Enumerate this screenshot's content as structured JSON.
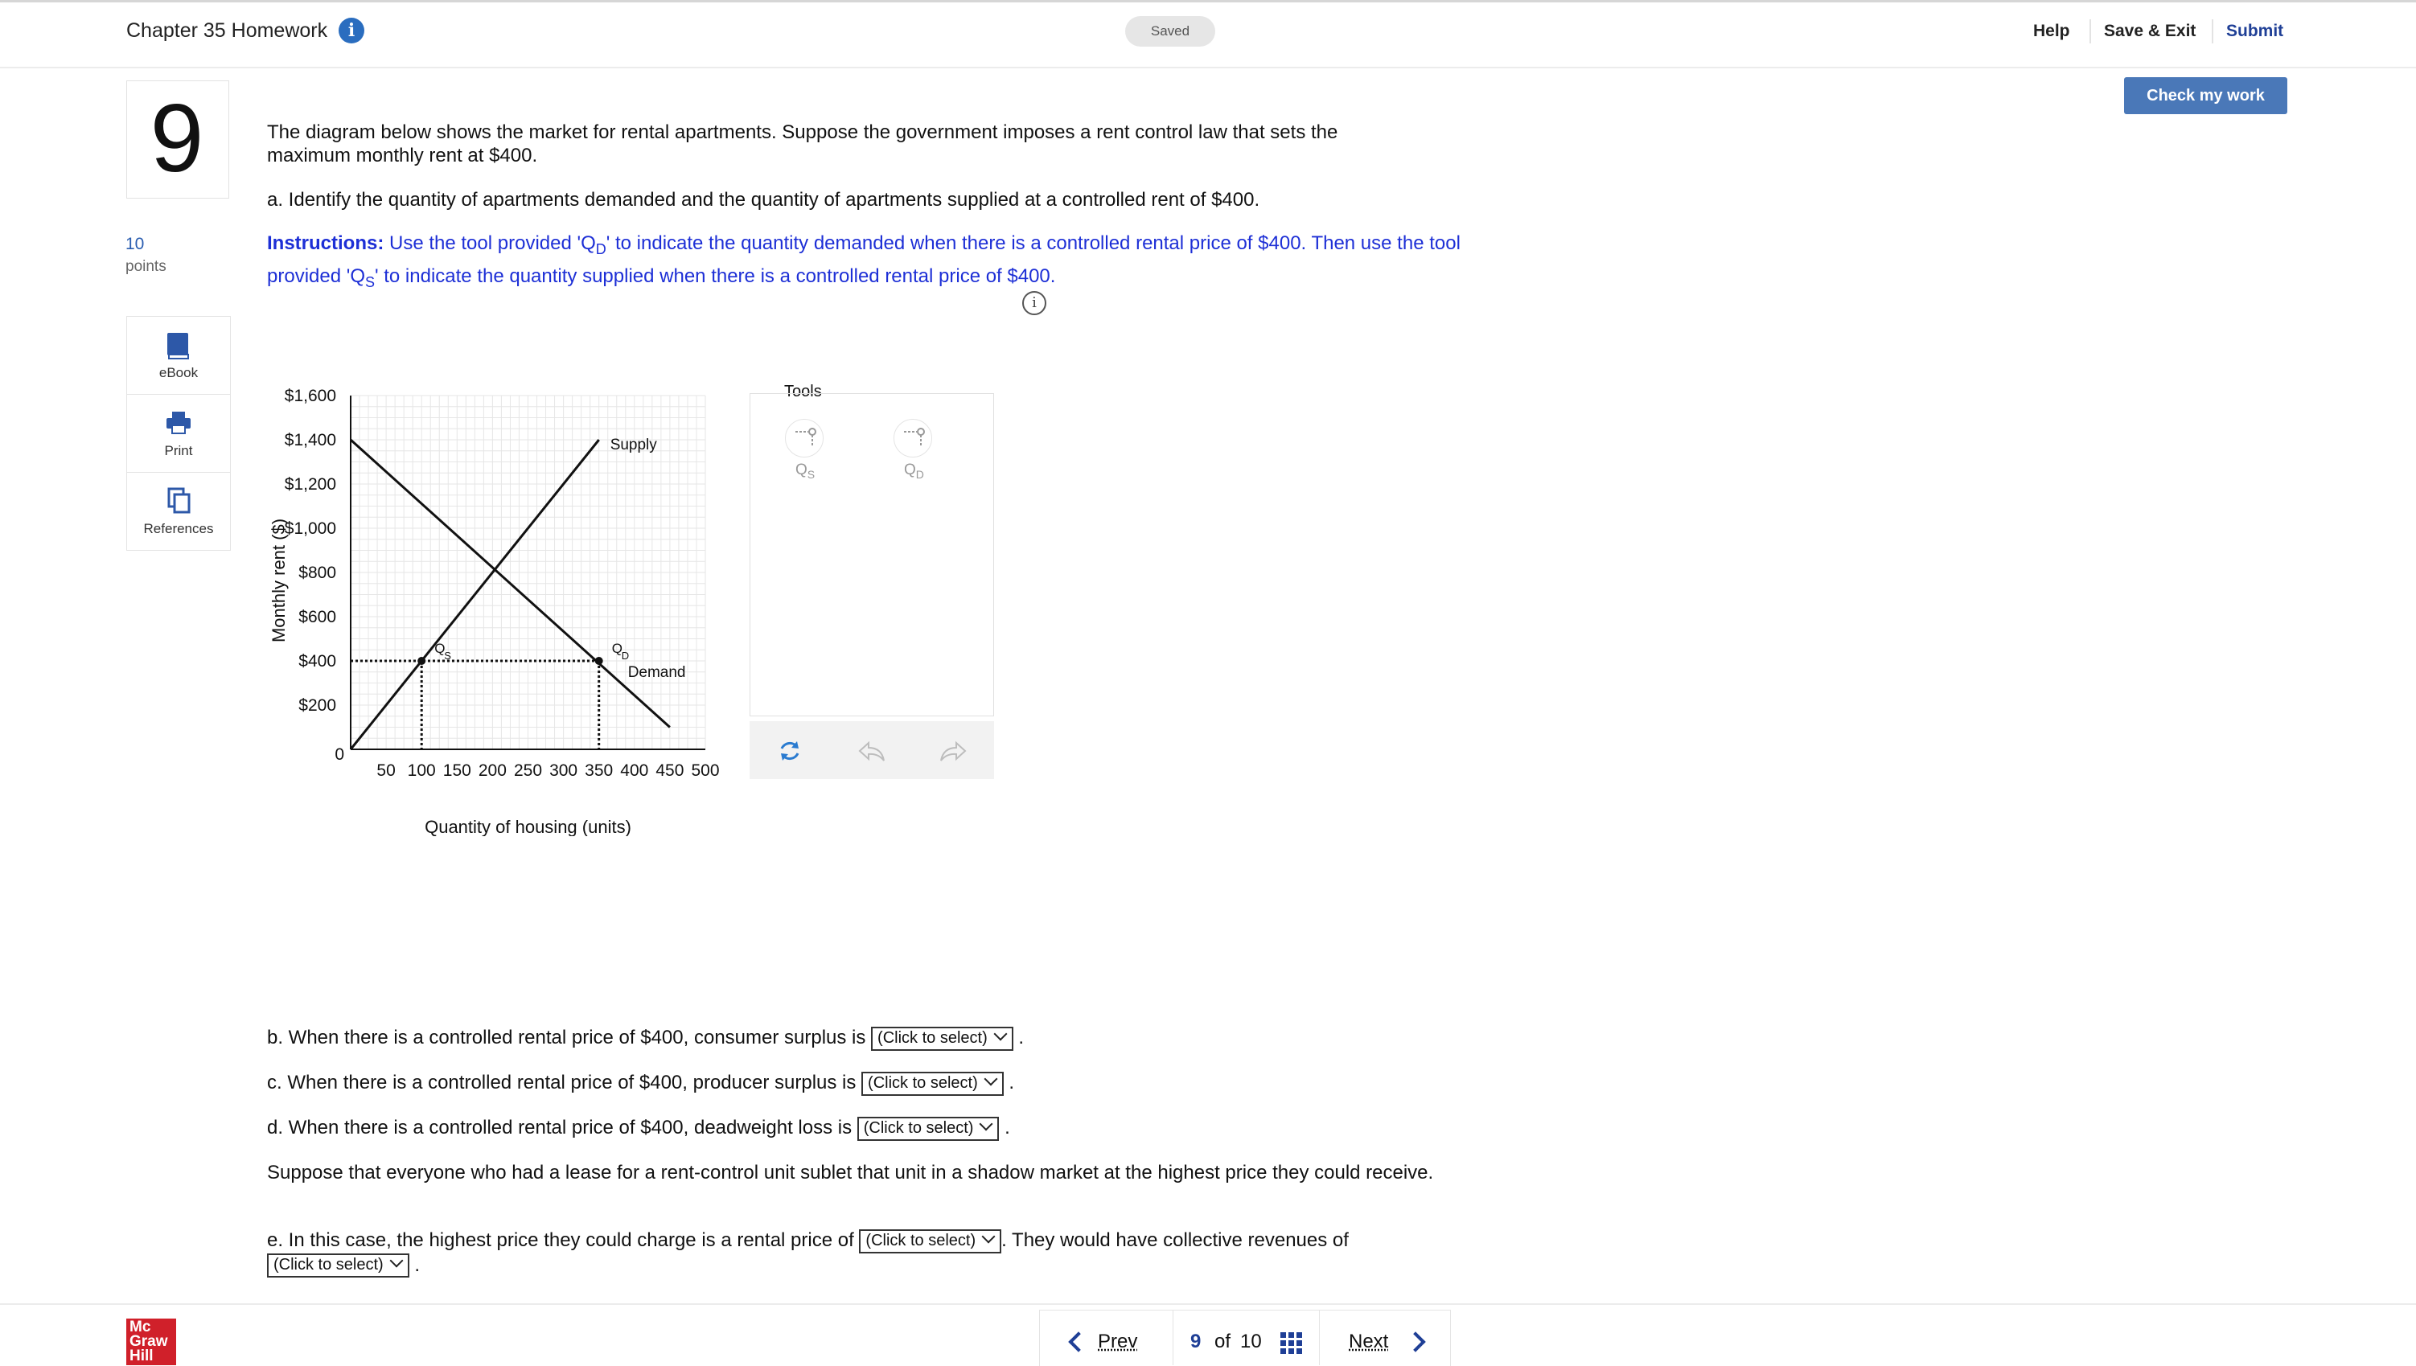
{
  "header": {
    "title": "Chapter 35 Homework",
    "saved": "Saved",
    "help": "Help",
    "save_exit": "Save & Exit",
    "submit": "Submit",
    "check": "Check my work"
  },
  "question": {
    "number": "9",
    "points_value": "10",
    "points_label": "points",
    "intro": "The diagram below shows the market for rental apartments. Suppose the government imposes a rent control law that sets the maximum monthly rent at $400.",
    "part_a": "a. Identify the quantity of apartments demanded and the quantity of apartments supplied at a controlled rent of $400.",
    "instr_bold": "Instructions:",
    "instr_1": " Use the tool provided 'Q",
    "instr_sub_d": "D",
    "instr_2": "' to indicate the quantity demanded when there is a controlled rental price of $400. Then use the tool provided 'Q",
    "instr_sub_s": "S",
    "instr_3": "' to indicate the quantity supplied when there is a controlled rental price of $400.",
    "part_b": "b. When there is a controlled rental price of $400, consumer surplus is",
    "part_c": "c. When there is a controlled rental price of $400, producer surplus is",
    "part_d": "d. When there is a controlled rental price of $400, deadweight loss is",
    "suppose": "Suppose that everyone who had a lease for a rent-control unit sublet that unit in a shadow market at the highest price they could receive.",
    "part_e_1": "e. In this case, the highest price they could charge is a rental price of",
    "part_e_2": ". They would have collective revenues of",
    "select_placeholder": "(Click to select)",
    "period": "."
  },
  "sidebar": {
    "ebook": "eBook",
    "print": "Print",
    "references": "References"
  },
  "tools": {
    "title": "Tools",
    "qs_label": "Q",
    "qs_sub": "S",
    "qd_label": "Q",
    "qd_sub": "D"
  },
  "chart_data": {
    "type": "line",
    "xlabel": "Quantity of housing (units)",
    "ylabel": "Monthly rent ($)",
    "xlim": [
      0,
      500
    ],
    "ylim": [
      0,
      1600
    ],
    "x_ticks": [
      "50",
      "100",
      "150",
      "200",
      "250",
      "300",
      "350",
      "400",
      "450",
      "500"
    ],
    "y_ticks": [
      "$200",
      "$400",
      "$600",
      "$800",
      "$1,000",
      "$1,200",
      "$1,400",
      "$1,600"
    ],
    "origin_label": "0",
    "grid": true,
    "series": [
      {
        "name": "Supply",
        "points": [
          [
            0,
            0
          ],
          [
            350,
            1400
          ]
        ]
      },
      {
        "name": "Demand",
        "points": [
          [
            0,
            1400
          ],
          [
            450,
            100
          ]
        ]
      }
    ],
    "price_ceiling": 400,
    "markers": [
      {
        "label": "Q",
        "sub": "S",
        "x": 100,
        "y": 400
      },
      {
        "label": "Q",
        "sub": "D",
        "x": 350,
        "y": 400
      }
    ]
  },
  "footer": {
    "logo_lines": [
      "Mc",
      "Graw",
      "Hill"
    ],
    "prev": "Prev",
    "page_current": "9",
    "page_of": "of",
    "page_total": "10",
    "next": "Next"
  }
}
